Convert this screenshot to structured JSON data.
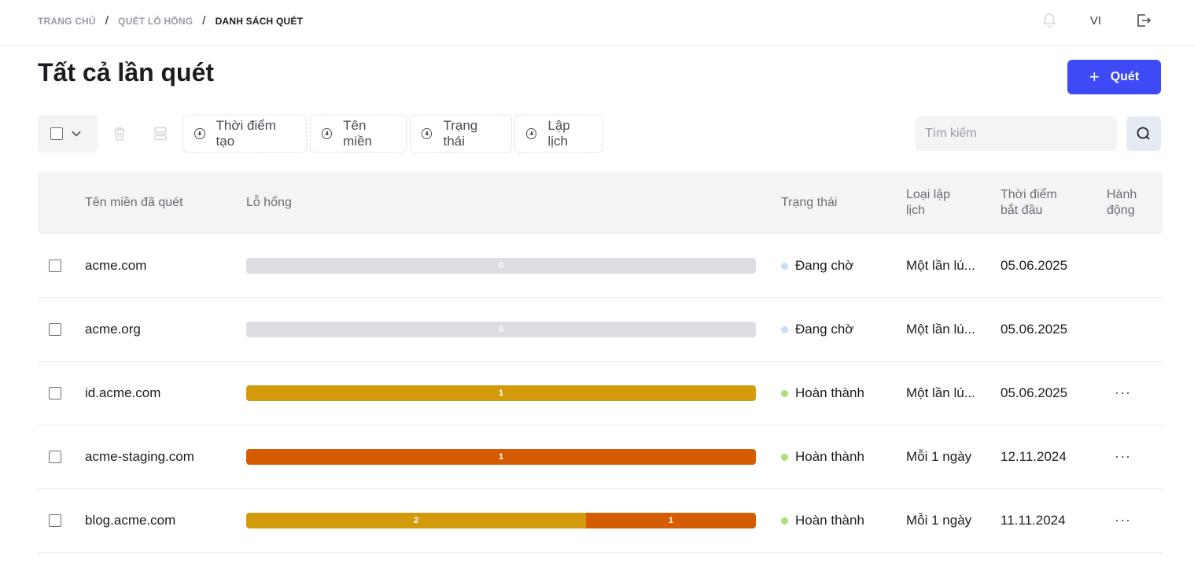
{
  "breadcrumb": [
    "TRANG CHỦ",
    "QUÉT LỖ HỔNG",
    "DANH SÁCH QUÉT"
  ],
  "header": {
    "language": "VI",
    "bell_icon": "bell-icon",
    "logout_icon": "logout-icon"
  },
  "page": {
    "title": "Tất cả lần quét",
    "scan_button": "Quét"
  },
  "toolbar": {
    "filters": [
      "Thời điểm tạo",
      "Tên miền",
      "Trạng thái",
      "Lập lịch"
    ],
    "search_placeholder": "Tìm kiếm"
  },
  "table": {
    "headers": {
      "domain": "Tên miền đã quét",
      "vulnerabilities": "Lỗ hổng",
      "status": "Trạng thái",
      "schedule_1": "Loại lập",
      "schedule_2": "lịch",
      "start_1": "Thời điểm",
      "start_2": "bắt đầu",
      "action_1": "Hành",
      "action_2": "động"
    },
    "rows": [
      {
        "domain": "acme.com",
        "segments": [
          {
            "value": "0",
            "color": "#dcdce2",
            "weight": 1
          }
        ],
        "status": "Đang chờ",
        "status_color": "#c6dcf7",
        "schedule": "Một lần lú...",
        "start": "05.06.2025",
        "has_actions": false
      },
      {
        "domain": "acme.org",
        "segments": [
          {
            "value": "0",
            "color": "#dcdce2",
            "weight": 1
          }
        ],
        "status": "Đang chờ",
        "status_color": "#c6dcf7",
        "schedule": "Một lần lú...",
        "start": "05.06.2025",
        "has_actions": false
      },
      {
        "domain": "id.acme.com",
        "segments": [
          {
            "value": "1",
            "color": "#d39a0c",
            "weight": 1
          }
        ],
        "status": "Hoàn thành",
        "status_color": "#a8e27a",
        "schedule": "Một lần lú...",
        "start": "05.06.2025",
        "has_actions": true
      },
      {
        "domain": "acme-staging.com",
        "segments": [
          {
            "value": "1",
            "color": "#d65c02",
            "weight": 1
          }
        ],
        "status": "Hoàn thành",
        "status_color": "#a8e27a",
        "schedule": "Mỗi 1 ngày",
        "start": "12.11.2024",
        "has_actions": true
      },
      {
        "domain": "blog.acme.com",
        "segments": [
          {
            "value": "2",
            "color": "#d39a0c",
            "weight": 2
          },
          {
            "value": "1",
            "color": "#d65c02",
            "weight": 1
          }
        ],
        "status": "Hoàn thành",
        "status_color": "#a8e27a",
        "schedule": "Mỗi 1 ngày",
        "start": "11.11.2024",
        "has_actions": true
      }
    ],
    "more_label": "···"
  }
}
